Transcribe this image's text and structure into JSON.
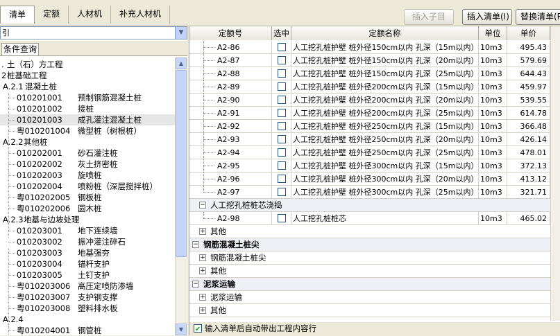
{
  "tabs": [
    "清单",
    "定额",
    "人材机",
    "补充人材机"
  ],
  "toolbar": {
    "insert_sub": "插入子目",
    "insert_list": "插入清单(I)",
    "replace_list": "替换清单(R)"
  },
  "left": {
    "combo_value": "引",
    "subtab": "条件查询",
    "tree": [
      {
        "code": ".",
        "name": "土（石）方工程"
      },
      {
        "code": "2",
        "name": "桩基础工程"
      },
      {
        "code": "A.2.1",
        "name": "混凝土桩"
      },
      {
        "code": "010201001",
        "name": "预制钢筋混凝土桩"
      },
      {
        "code": "010201002",
        "name": "接桩"
      },
      {
        "code": "010201003",
        "name": "成孔灌注混凝土桩"
      },
      {
        "code": "粤010201004",
        "name": "微型桩（树根桩）"
      },
      {
        "code": "A.2.2",
        "name": "其他桩"
      },
      {
        "code": "010202001",
        "name": "砂石灌注桩"
      },
      {
        "code": "010202002",
        "name": "灰土挤密桩"
      },
      {
        "code": "010202003",
        "name": "旋喷桩"
      },
      {
        "code": "010202004",
        "name": "喷粉桩（深层搅拌桩）"
      },
      {
        "code": "粤010202005",
        "name": "钢板桩"
      },
      {
        "code": "粤010202006",
        "name": "圆木桩"
      },
      {
        "code": "A.2.3",
        "name": "地基与边坡处理"
      },
      {
        "code": "010203001",
        "name": "地下连续墙"
      },
      {
        "code": "010203002",
        "name": "振冲灌注碎石"
      },
      {
        "code": "010203003",
        "name": "地基强夯"
      },
      {
        "code": "010203004",
        "name": "锚杆支护"
      },
      {
        "code": "010203005",
        "name": "土钉支护"
      },
      {
        "code": "粤010203006",
        "name": "高压定喷防渗墙"
      },
      {
        "code": "粤010203007",
        "name": "支护钢支撑"
      },
      {
        "code": "粤010203008",
        "name": "塑料排水板"
      },
      {
        "code": "A.2.4",
        "name": ""
      },
      {
        "code": "粤010204001",
        "name": "钢管桩"
      }
    ]
  },
  "grid": {
    "headers": [
      "定额号",
      "选中",
      "定额名称",
      "单位",
      "单价"
    ],
    "items": [
      {
        "code": "A2-86",
        "name": "人工挖孔桩护壁 桩外径150cm以内 孔深（15m以内）",
        "unit": "10m3",
        "price": "495.43"
      },
      {
        "code": "A2-87",
        "name": "人工挖孔桩护壁 桩外径150cm以内 孔深（20m以内）",
        "unit": "10m3",
        "price": "579.69"
      },
      {
        "code": "A2-88",
        "name": "人工挖孔桩护壁 桩外径150cm以内 孔深（25m以内）",
        "unit": "10m3",
        "price": "644.43"
      },
      {
        "code": "A2-89",
        "name": "人工挖孔桩护壁 桩外径200cm以内 孔深（15m以内）",
        "unit": "10m3",
        "price": "459.97"
      },
      {
        "code": "A2-90",
        "name": "人工挖孔桩护壁 桩外径200cm以内 孔深（20m以内）",
        "unit": "10m3",
        "price": "539.55"
      },
      {
        "code": "A2-91",
        "name": "人工挖孔桩护壁 桩外径200cm以内 孔深（25m以内）",
        "unit": "10m3",
        "price": "614.78"
      },
      {
        "code": "A2-92",
        "name": "人工挖孔桩护壁 桩外径250cm以内 孔深（15m以内）",
        "unit": "10m3",
        "price": "366.48"
      },
      {
        "code": "A2-93",
        "name": "人工挖孔桩护壁 桩外径250cm以内 孔深（20m以内）",
        "unit": "10m3",
        "price": "426.14"
      },
      {
        "code": "A2-94",
        "name": "人工挖孔桩护壁 桩外径250cm以内 孔深（25m以内）",
        "unit": "10m3",
        "price": "478.01"
      },
      {
        "code": "A2-95",
        "name": "人工挖孔桩护壁 桩外径300cm以内 孔深（15m以内）",
        "unit": "10m3",
        "price": "372.13"
      },
      {
        "code": "A2-96",
        "name": "人工挖孔桩护壁 桩外径300cm以内 孔深（20m以内）",
        "unit": "10m3",
        "price": "413.12"
      },
      {
        "code": "A2-97",
        "name": "人工挖孔桩护壁 桩外径300cm以内 孔深（25m以内）",
        "unit": "10m3",
        "price": "321.71"
      }
    ],
    "group1": "人工挖孔桩桩芯浇捣",
    "item98": {
      "code": "A2-98",
      "name": "人工挖孔桩桩芯",
      "unit": "10m3",
      "price": "465.02"
    },
    "other": "其他",
    "sec2": "钢筋混凝土桩尖",
    "sec2_sub": "钢筋混凝土桩尖",
    "sec3": "泥浆运输",
    "sec3_sub": "泥浆运输"
  },
  "bottom_label": "输入清单后自动带出工程内容行"
}
